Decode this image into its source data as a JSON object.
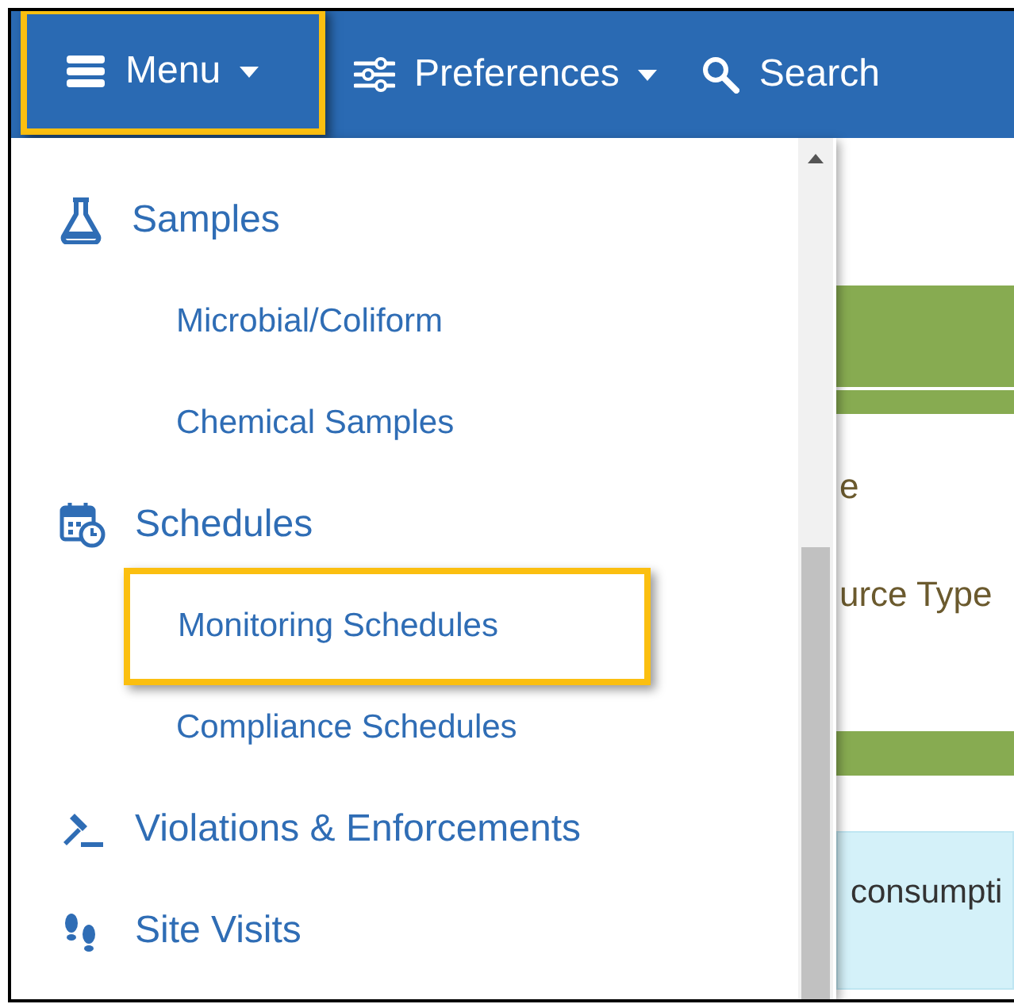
{
  "navbar": {
    "items": [
      {
        "label": "Menu",
        "kind": "menu",
        "highlighted": true
      },
      {
        "label": "Preferences",
        "kind": "preferences",
        "highlighted": false
      },
      {
        "label": "Search",
        "kind": "search",
        "highlighted": false
      }
    ]
  },
  "menu": {
    "sections": [
      {
        "label": "Samples",
        "kind": "samples",
        "children": [
          {
            "label": "Microbial/Coliform",
            "highlighted": false
          },
          {
            "label": "Chemical Samples",
            "highlighted": false
          }
        ]
      },
      {
        "label": "Schedules",
        "kind": "schedules",
        "children": [
          {
            "label": "Monitoring Schedules",
            "highlighted": true
          },
          {
            "label": "Compliance Schedules",
            "highlighted": false
          }
        ]
      },
      {
        "label": "Violations & Enforcements",
        "kind": "violations"
      },
      {
        "label": "Site Visits",
        "kind": "visits"
      }
    ]
  },
  "page": {
    "texts": [
      "e",
      "urce Type",
      "consumpti"
    ]
  }
}
